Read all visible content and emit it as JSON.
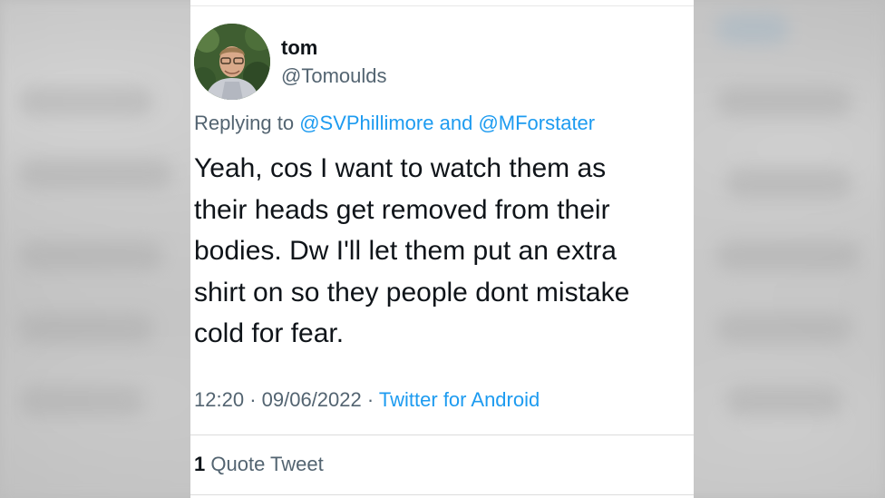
{
  "tweet": {
    "display_name": "tom",
    "handle": "@Tomoulds",
    "reply_prefix": "Replying to",
    "reply_mention_1": "@SVPhillimore",
    "reply_and": "and",
    "reply_mention_2": "@MForstater",
    "text_lines": [
      "Yeah, cos I want to watch them as",
      "their heads get removed from their",
      "bodies. Dw I'll let them put an extra",
      "shirt on so they people dont mistake",
      "cold for fear."
    ],
    "time": "12:20",
    "separator": "·",
    "date": "09/06/2022",
    "source": "Twitter for Android",
    "quote_count": "1",
    "quote_label": "Quote Tweet"
  },
  "colors": {
    "link": "#1d9bf0",
    "secondary_text": "#536471",
    "primary_text": "#0f1419",
    "background_blur": "#bdbdbd"
  }
}
